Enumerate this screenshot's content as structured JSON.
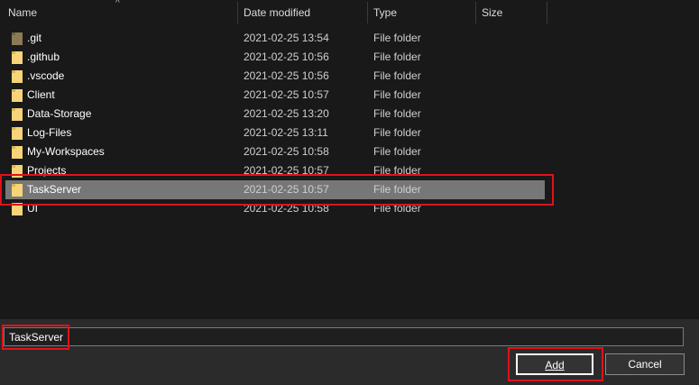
{
  "columns": {
    "name": "Name",
    "date_modified": "Date modified",
    "type": "Type",
    "size": "Size"
  },
  "sort_indicator": "^",
  "files": [
    {
      "name": ".git",
      "date": "2021-02-25 13:54",
      "type": "File folder"
    },
    {
      "name": ".github",
      "date": "2021-02-25 10:56",
      "type": "File folder"
    },
    {
      "name": ".vscode",
      "date": "2021-02-25 10:56",
      "type": "File folder"
    },
    {
      "name": "Client",
      "date": "2021-02-25 10:57",
      "type": "File folder"
    },
    {
      "name": "Data-Storage",
      "date": "2021-02-25 13:20",
      "type": "File folder"
    },
    {
      "name": "Log-Files",
      "date": "2021-02-25 13:11",
      "type": "File folder"
    },
    {
      "name": "My-Workspaces",
      "date": "2021-02-25 10:58",
      "type": "File folder"
    },
    {
      "name": "Projects",
      "date": "2021-02-25 10:57",
      "type": "File folder"
    },
    {
      "name": "TaskServer",
      "date": "2021-02-25 10:57",
      "type": "File folder",
      "selected": true
    },
    {
      "name": "UI",
      "date": "2021-02-25 10:58",
      "type": "File folder"
    }
  ],
  "footer": {
    "filename_value": "TaskServer",
    "add_label": "Add",
    "cancel_label": "Cancel"
  },
  "colors": {
    "background": "#191919",
    "selected_row": "#777777",
    "highlight_box": "#e0121b",
    "folder": "#f6d477",
    "folder_git": "#8a7a55"
  },
  "icons": {
    "folder": "folder-icon"
  }
}
